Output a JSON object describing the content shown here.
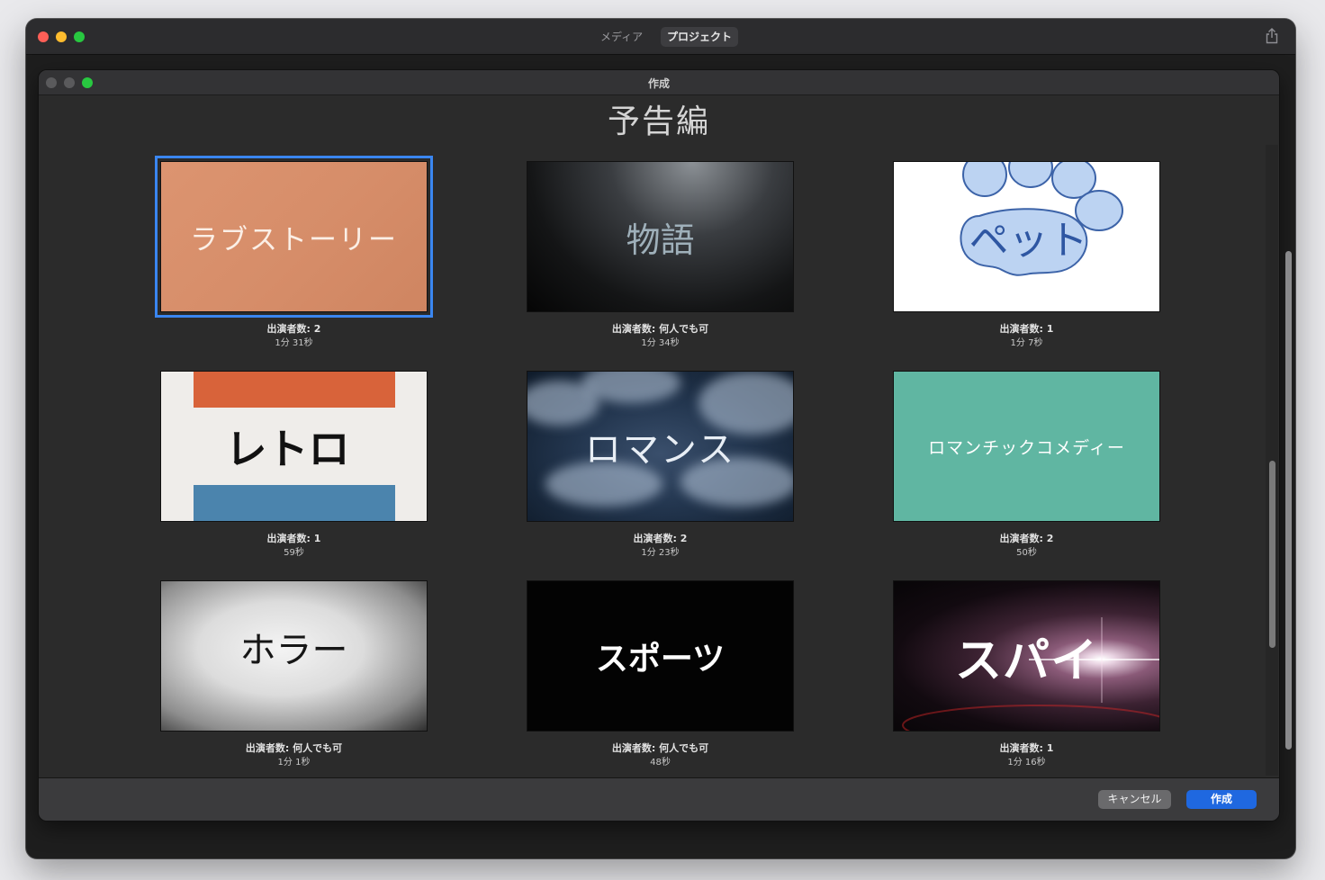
{
  "app": {
    "tabs": [
      {
        "label": "メディア"
      },
      {
        "label": "プロジェクト"
      }
    ],
    "share_icon": "share-icon"
  },
  "sheet": {
    "window_title": "作成",
    "heading": "予告編"
  },
  "trailers": [
    {
      "thumb_text": "ラブストーリー",
      "cast": "出演者数: 2",
      "duration": "1分 31秒",
      "selected": true
    },
    {
      "thumb_text": "物語",
      "cast": "出演者数: 何人でも可",
      "duration": "1分 34秒"
    },
    {
      "thumb_text": "ペット",
      "cast": "出演者数: 1",
      "duration": "1分 7秒"
    },
    {
      "thumb_text": "レトロ",
      "cast": "出演者数: 1",
      "duration": "59秒"
    },
    {
      "thumb_text": "ロマンス",
      "cast": "出演者数: 2",
      "duration": "1分 23秒"
    },
    {
      "thumb_text": "ロマンチックコメディー",
      "cast": "出演者数: 2",
      "duration": "50秒"
    },
    {
      "thumb_text": "ホラー",
      "cast": "出演者数: 何人でも可",
      "duration": "1分 1秒"
    },
    {
      "thumb_text": "スポーツ",
      "cast": "出演者数: 何人でも可",
      "duration": "48秒"
    },
    {
      "thumb_text": "スパイ",
      "cast": "出演者数: 1",
      "duration": "1分 16秒"
    }
  ],
  "footer": {
    "cancel_label": "キャンセル",
    "create_label": "作成"
  },
  "colors": {
    "selection": "#3a86f0",
    "primary_button": "#1f68e0"
  }
}
